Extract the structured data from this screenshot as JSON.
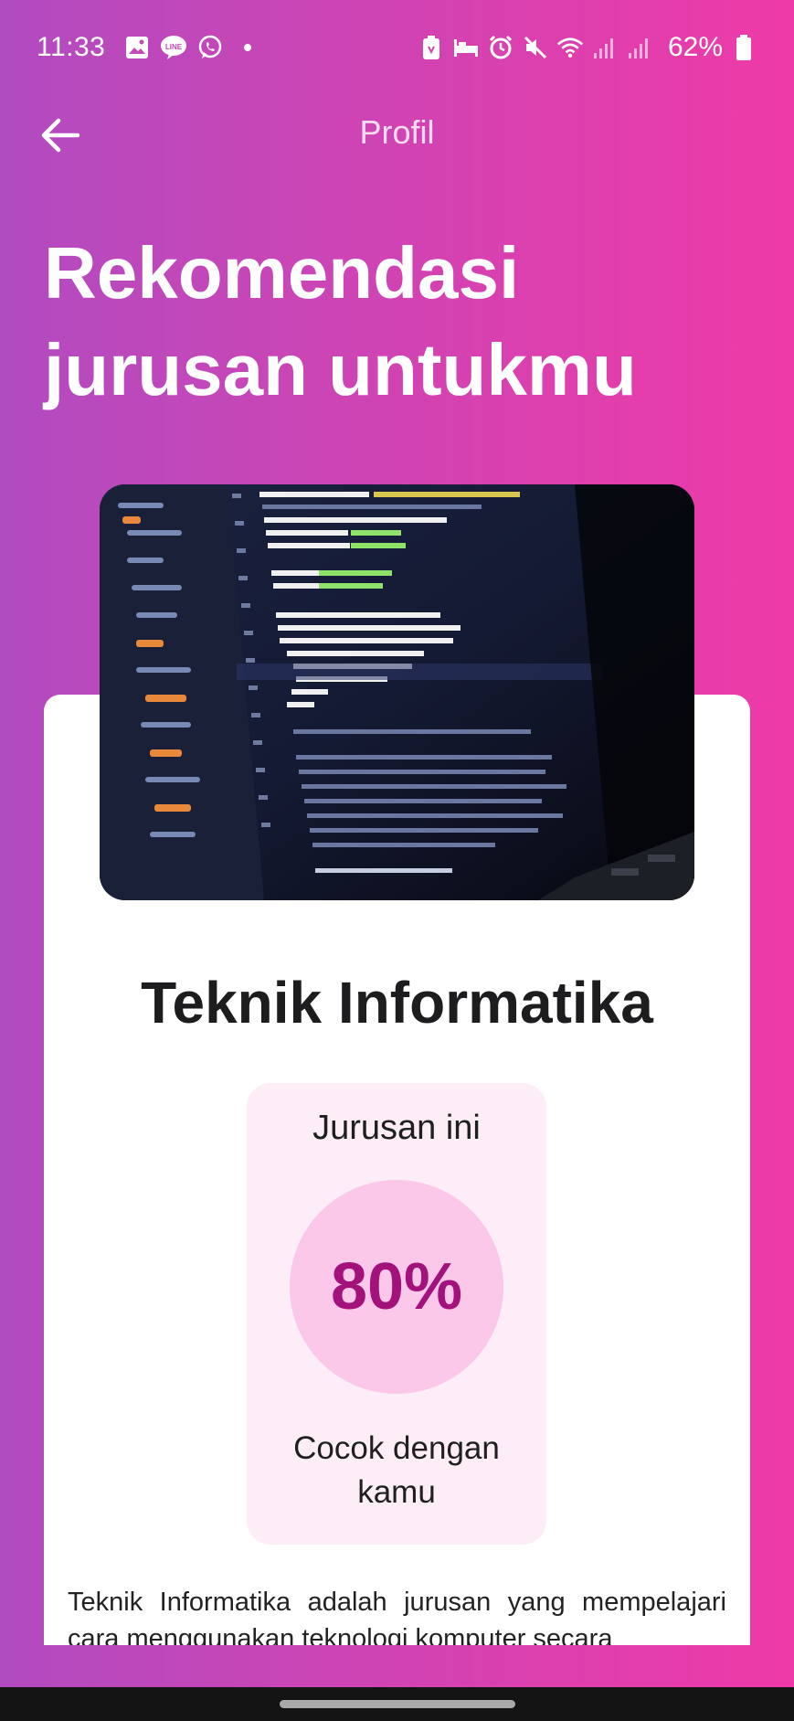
{
  "status_bar": {
    "time": "11:33",
    "battery": "62%",
    "left_icons": [
      "gallery-icon",
      "line-icon",
      "whatsapp-icon"
    ],
    "right_icons": [
      "battery-saver-icon",
      "bed-icon",
      "alarm-icon",
      "mute-icon",
      "wifi-icon",
      "signal-icon",
      "signal-icon",
      "battery-icon"
    ]
  },
  "app_bar": {
    "title": "Profil"
  },
  "headline": "Rekomendasi jurusan untukmu",
  "card": {
    "major_name": "Teknik Informatika",
    "match_top_text": "Jurusan ini",
    "match_percent": "80%",
    "match_bottom_text": "Cocok dengan kamu",
    "description": "Teknik Informatika adalah jurusan yang mempelajari cara menggunakan teknologi komputer secara"
  },
  "colors": {
    "gradient_left": "#B14BC0",
    "gradient_right": "#EE3AA8",
    "match_box_bg": "#FDEDF7",
    "circle_bg": "#FCC8EA",
    "percent_text": "#A3117A"
  }
}
